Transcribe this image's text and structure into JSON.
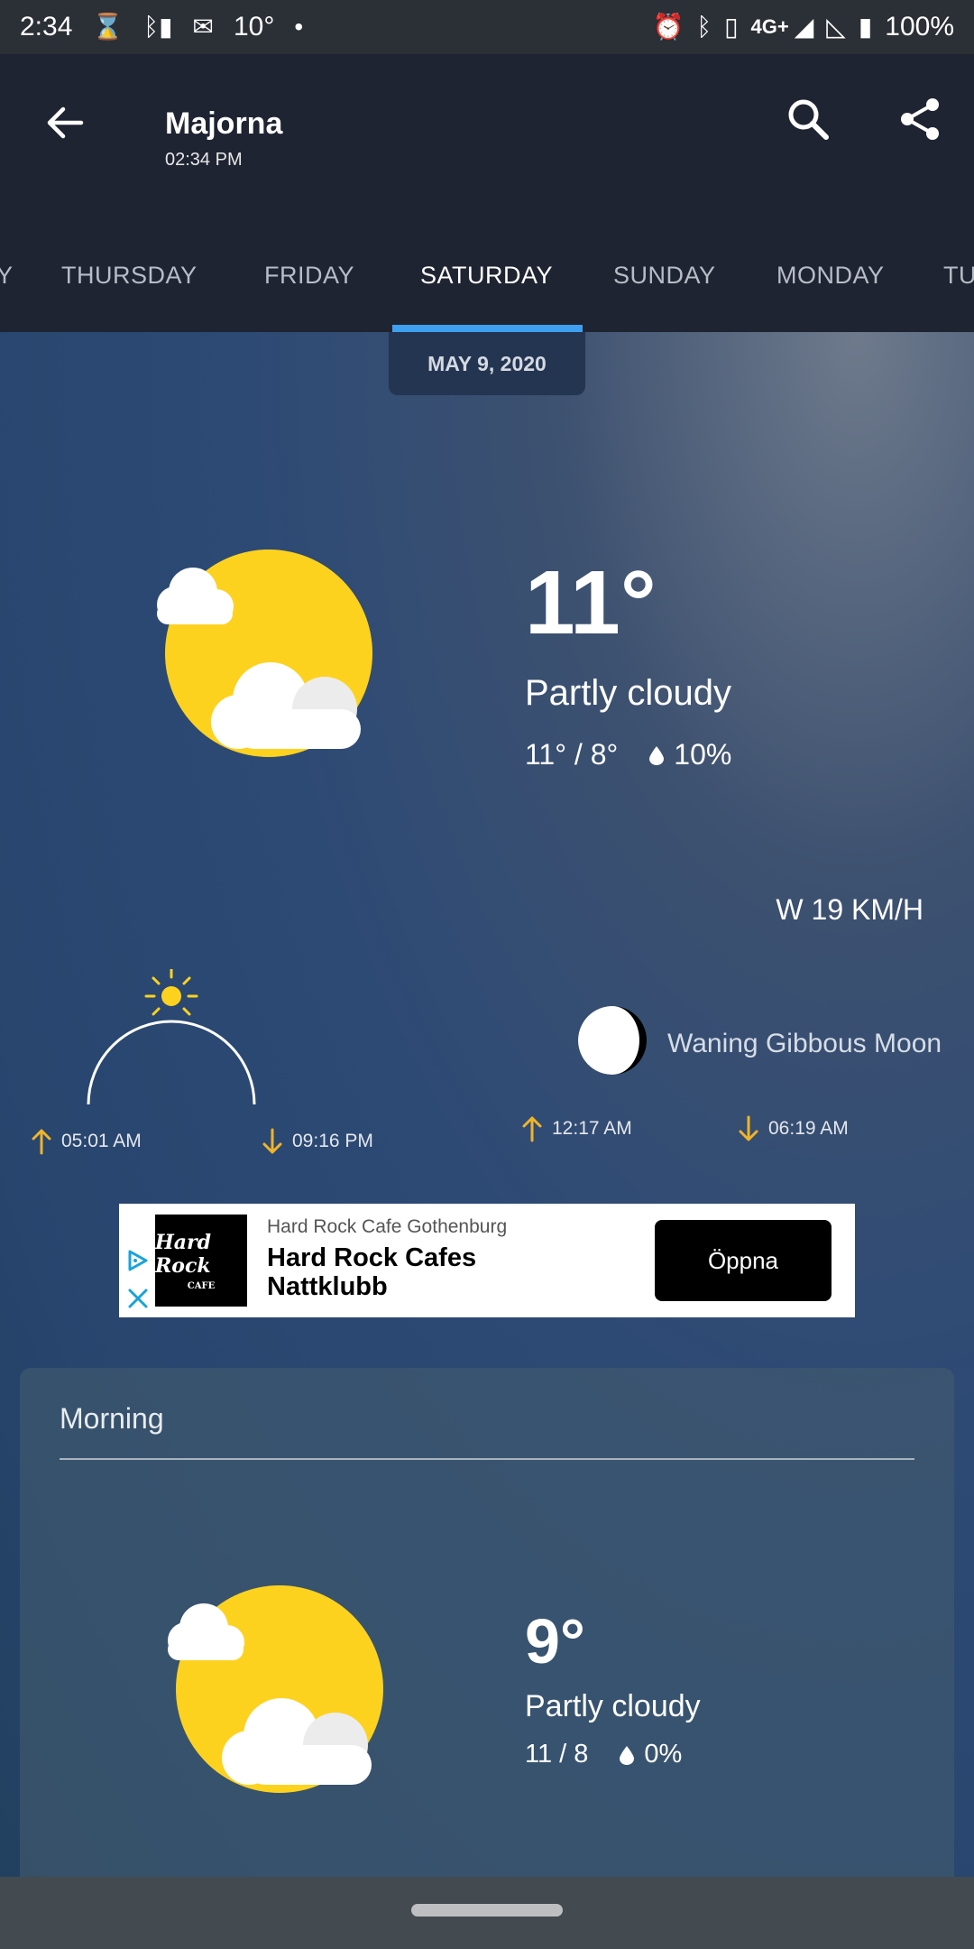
{
  "status_bar": {
    "time": "2:34",
    "temp": "10°",
    "network": "4G+",
    "battery": "100%"
  },
  "header": {
    "location": "Majorna",
    "time": "02:34 PM"
  },
  "tabs": [
    {
      "label": "Y"
    },
    {
      "label": "THURSDAY"
    },
    {
      "label": "FRIDAY"
    },
    {
      "label": "SATURDAY"
    },
    {
      "label": "SUNDAY"
    },
    {
      "label": "MONDAY"
    },
    {
      "label": "TU"
    }
  ],
  "current": {
    "date": "MAY 9, 2020",
    "temperature": "11°",
    "condition": "Partly cloudy",
    "high_low": "11° / 8°",
    "precip": "10%",
    "wind": "W 19 KM/H",
    "sunrise": "05:01 AM",
    "sunset": "09:16 PM",
    "moon_phase": "Waning Gibbous Moon",
    "moonrise": "12:17 AM",
    "moonset": "06:19 AM"
  },
  "ad": {
    "advertiser": "Hard Rock Cafe Gothenburg",
    "headline": "Hard Rock Cafes Nattklubb",
    "logo_text": "Hard Rock",
    "logo_subtext": "CAFE",
    "cta": "Öppna"
  },
  "morning": {
    "title": "Morning",
    "temperature": "9°",
    "condition": "Partly cloudy",
    "high_low": "11 / 8",
    "precip": "0%"
  },
  "colors": {
    "sun": "#fdd21f",
    "accent": "#3ea0f0",
    "arrow": "#f0b429"
  }
}
